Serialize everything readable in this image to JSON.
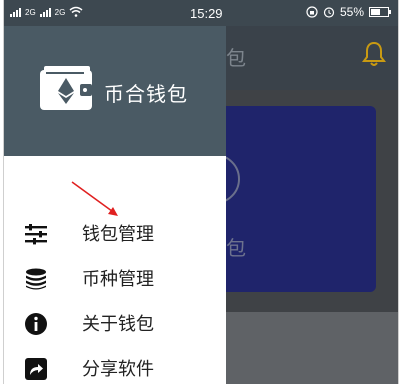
{
  "status_bar": {
    "carrier_tag_1": "2G",
    "carrier_tag_2": "2G",
    "time": "15:29",
    "battery_text": "55%",
    "battery_level": 0.55
  },
  "background_page": {
    "title_fragment": "包",
    "card_text_fragment": "包"
  },
  "drawer": {
    "app_name": "币合钱包",
    "menu": [
      {
        "label": "钱包管理",
        "icon": "sliders-icon"
      },
      {
        "label": "币种管理",
        "icon": "coins-stack-icon"
      },
      {
        "label": "关于钱包",
        "icon": "info-icon"
      },
      {
        "label": "分享软件",
        "icon": "share-icon"
      }
    ]
  },
  "colors": {
    "drawer_header": "#4a5a64",
    "status_bar": "#3d4850",
    "bell": "#c99a12",
    "card": "#1f246b",
    "annotation_arrow": "#e02020"
  }
}
